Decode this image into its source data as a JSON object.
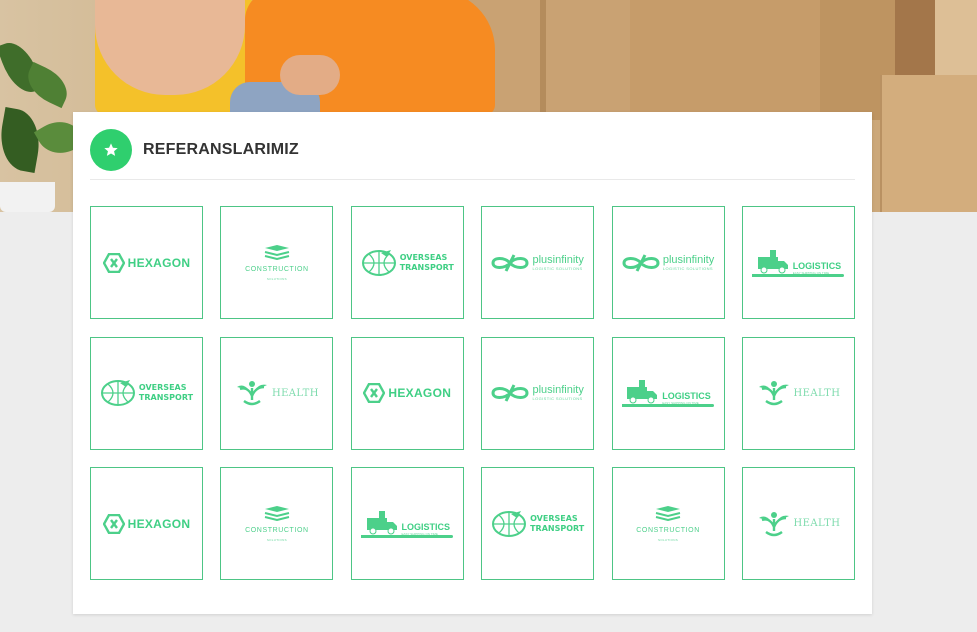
{
  "section": {
    "title": "REFERANSLARIMIZ",
    "icon": "star-icon"
  },
  "accent_color": "#2fcf6e",
  "logo_color": "#4cd08a",
  "references": [
    {
      "type": "hexagon",
      "name": "HEXAGON"
    },
    {
      "type": "construction",
      "name": "CONSTRUCTION",
      "sub": "SOLUTIONS"
    },
    {
      "type": "overseas",
      "name1": "OVERSEAS",
      "name2": "TRANSPORT"
    },
    {
      "type": "plusinfinity",
      "name": "plusinfinity",
      "sub": "LOGISTIC SOLUTIONS"
    },
    {
      "type": "plusinfinity",
      "name": "plusinfinity",
      "sub": "LOGISTIC SOLUTIONS"
    },
    {
      "type": "logistics",
      "name": "LOGISTICS",
      "sub": "EASY SHIPPING ON TIME"
    },
    {
      "type": "overseas",
      "name1": "OVERSEAS",
      "name2": "TRANSPORT"
    },
    {
      "type": "health",
      "name": "HEALTH"
    },
    {
      "type": "hexagon",
      "name": "HEXAGON"
    },
    {
      "type": "plusinfinity",
      "name": "plusinfinity",
      "sub": "LOGISTIC SOLUTIONS"
    },
    {
      "type": "logistics",
      "name": "LOGISTICS",
      "sub": "EASY SHIPPING ON TIME"
    },
    {
      "type": "health",
      "name": "HEALTH"
    },
    {
      "type": "hexagon",
      "name": "HEXAGON"
    },
    {
      "type": "construction",
      "name": "CONSTRUCTION",
      "sub": "SOLUTIONS"
    },
    {
      "type": "logistics",
      "name": "LOGISTICS",
      "sub": "EASY SHIPPING ON TIME"
    },
    {
      "type": "overseas",
      "name1": "OVERSEAS",
      "name2": "TRANSPORT"
    },
    {
      "type": "construction",
      "name": "CONSTRUCTION",
      "sub": "SOLUTIONS"
    },
    {
      "type": "health",
      "name": "HEALTH"
    }
  ]
}
